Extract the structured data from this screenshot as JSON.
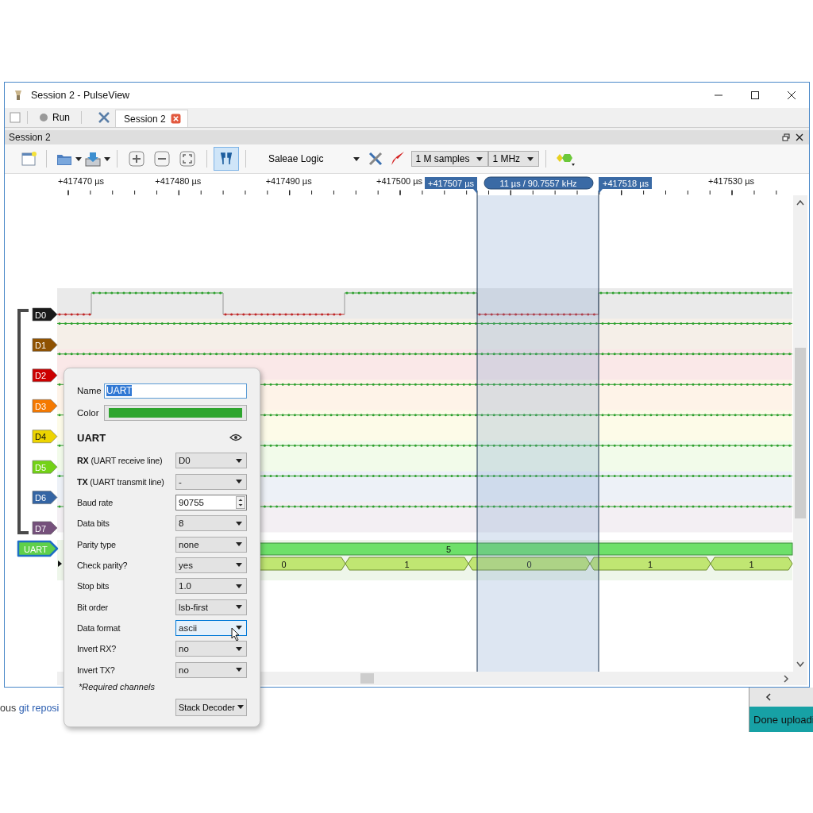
{
  "window": {
    "title": "Session 2 - PulseView"
  },
  "main_toolbar": {
    "run_label": "Run",
    "tabs": [
      {
        "label": "Session 2",
        "selected": true
      }
    ]
  },
  "dock": {
    "title": "Session 2"
  },
  "toolbar": {
    "device": "Saleae Logic",
    "sample_count": "1 M samples",
    "sample_rate": "1 MHz",
    "cursors_on": true
  },
  "ruler": {
    "ticks": [
      "+417470 µs",
      "+417480 µs",
      "+417490 µs",
      "+417500 µs",
      "+417530 µs"
    ],
    "cursors": [
      "+417507 µs",
      "+417518 µs"
    ],
    "measurement": "11 µs / 90.7557 kHz"
  },
  "channels": [
    {
      "name": "D0",
      "color": "#1a1a1a"
    },
    {
      "name": "D1",
      "color": "#8f5202"
    },
    {
      "name": "D2",
      "color": "#cc0000"
    },
    {
      "name": "D3",
      "color": "#f57900"
    },
    {
      "name": "D4",
      "color": "#edd400"
    },
    {
      "name": "D5",
      "color": "#73d216"
    },
    {
      "name": "D6",
      "color": "#3465a4"
    },
    {
      "name": "D7",
      "color": "#75507b"
    }
  ],
  "decoder": {
    "name": "UART",
    "color": "#5fd04a",
    "row_value": "5",
    "annotations": [
      "0",
      "1",
      "0",
      "1",
      "1"
    ]
  },
  "popup": {
    "name_label": "Name",
    "name_value": "UART",
    "name_selected": true,
    "color_label": "Color",
    "title": "UART",
    "options": [
      {
        "label": "**RX** (UART receive line)",
        "kind": "combo",
        "value": "D0",
        "focused": false
      },
      {
        "label": "**TX** (UART transmit line)",
        "kind": "combo",
        "value": "-",
        "focused": false
      },
      {
        "label": "Baud rate",
        "kind": "spin",
        "value": "90755",
        "focused": false
      },
      {
        "label": "Data bits",
        "kind": "combo",
        "value": "8",
        "focused": false
      },
      {
        "label": "Parity type",
        "kind": "combo",
        "value": "none",
        "focused": false
      },
      {
        "label": "Check parity?",
        "kind": "combo",
        "value": "yes",
        "focused": false
      },
      {
        "label": "Stop bits",
        "kind": "combo",
        "value": "1.0",
        "focused": false
      },
      {
        "label": "Bit order",
        "kind": "combo",
        "value": "lsb-first",
        "focused": false
      },
      {
        "label": "Data format",
        "kind": "combo",
        "value": "ascii",
        "focused": true
      },
      {
        "label": "Invert RX?",
        "kind": "combo",
        "value": "no",
        "focused": false
      },
      {
        "label": "Invert TX?",
        "kind": "combo",
        "value": "no",
        "focused": false
      }
    ],
    "note": "*Required channels",
    "stack_button": "Stack Decoder"
  },
  "background": {
    "text": "ous",
    "link": "git reposi",
    "status": "Done uploadi"
  }
}
